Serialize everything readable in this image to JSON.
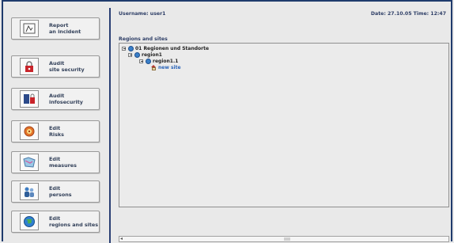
{
  "sidebar": {
    "items": [
      {
        "line1": "Report",
        "line2": "an incident",
        "icon": "incident-board-icon"
      },
      {
        "line1": "Audit",
        "line2": "site security",
        "icon": "padlock-icon"
      },
      {
        "line1": "Audit",
        "line2": "infosecurity",
        "icon": "server-lock-icon"
      },
      {
        "line1": "Edit",
        "line2": "Risks",
        "icon": "risk-alert-icon"
      },
      {
        "line1": "Edit",
        "line2": "measures",
        "icon": "measures-map-icon"
      },
      {
        "line1": "Edit",
        "line2": "persons",
        "icon": "persons-icon"
      },
      {
        "line1": "Edit",
        "line2": "regions and sites",
        "icon": "globe-icon"
      }
    ]
  },
  "header": {
    "username": "Username: user1",
    "datetime": "Date: 27.10.05  Time: 12:47"
  },
  "tree": {
    "title": "Regions and sites",
    "nodes": [
      {
        "label": "01 Regionen und Standorte",
        "icon": "globe-icon"
      },
      {
        "label": "region1",
        "icon": "globe-icon"
      },
      {
        "label": "region1.1",
        "icon": "globe-icon"
      },
      {
        "label": "new site",
        "icon": "home-icon"
      }
    ]
  },
  "colors": {
    "frame": "#1f3b6d",
    "link": "#2a64b8",
    "label": "#33415a"
  }
}
